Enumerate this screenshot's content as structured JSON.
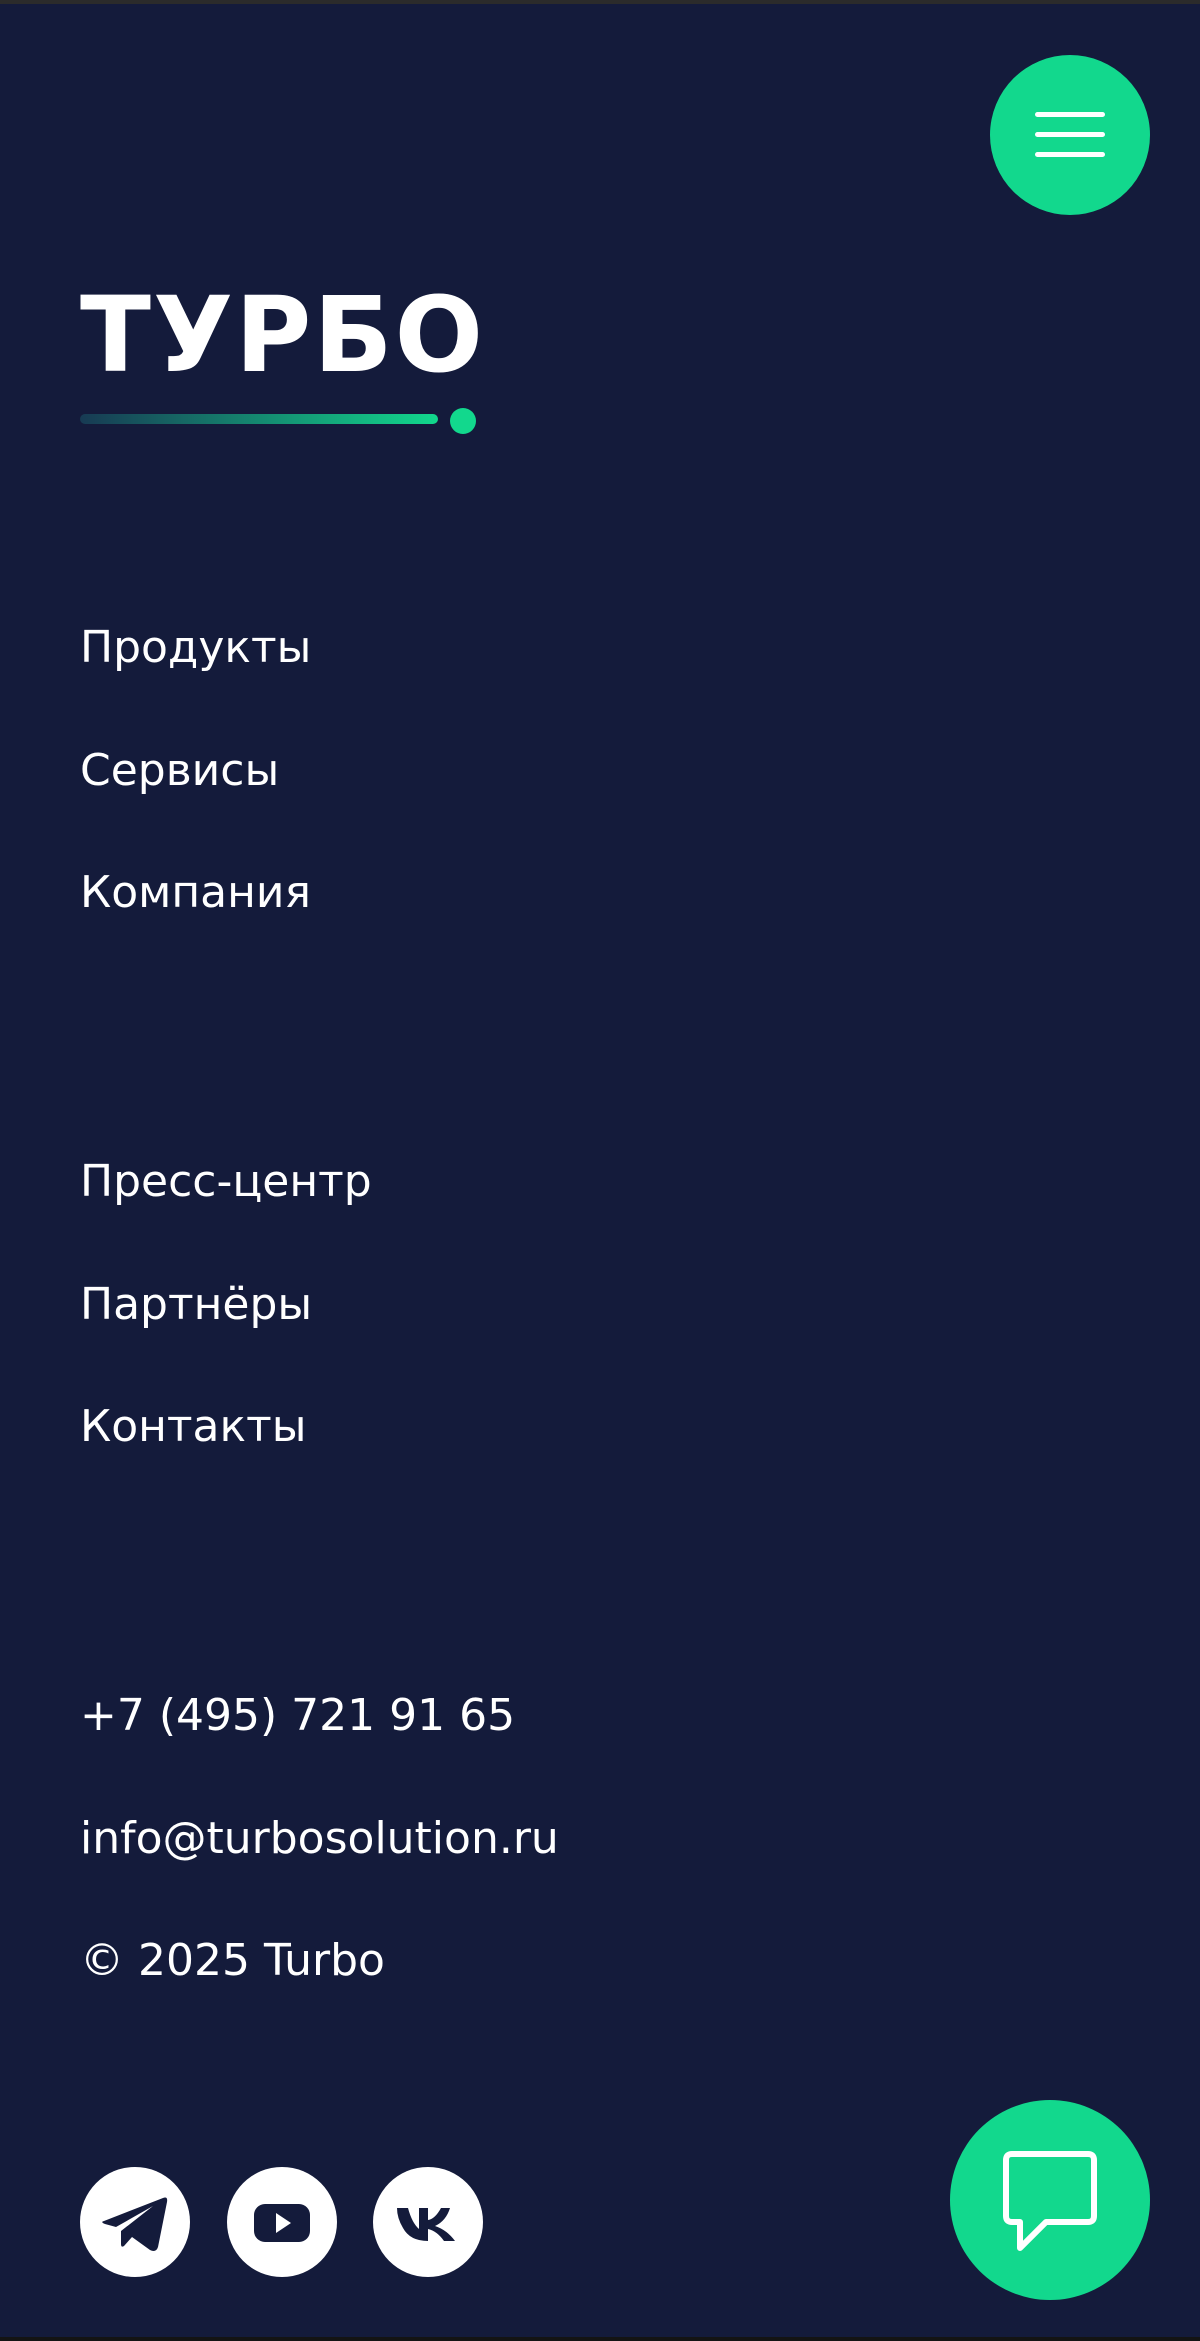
{
  "colors": {
    "background": "#141b3b",
    "accent": "#12d88d",
    "text": "#ffffff"
  },
  "header": {
    "menu_icon": "hamburger-menu-icon"
  },
  "logo": {
    "text": "ТУРБО"
  },
  "nav_primary": [
    {
      "label": "Продукты"
    },
    {
      "label": "Сервисы"
    },
    {
      "label": "Компания"
    }
  ],
  "nav_secondary": [
    {
      "label": "Пресс-центр"
    },
    {
      "label": "Партнёры"
    },
    {
      "label": "Контакты"
    }
  ],
  "contacts": {
    "phone": "+7 (495) 721 91 65",
    "email": "info@turbosolution.ru",
    "copyright": "© 2025 Turbo"
  },
  "social": [
    {
      "icon": "telegram-icon"
    },
    {
      "icon": "youtube-icon"
    },
    {
      "icon": "vk-icon"
    }
  ],
  "chat": {
    "icon": "chat-bubble-icon"
  }
}
